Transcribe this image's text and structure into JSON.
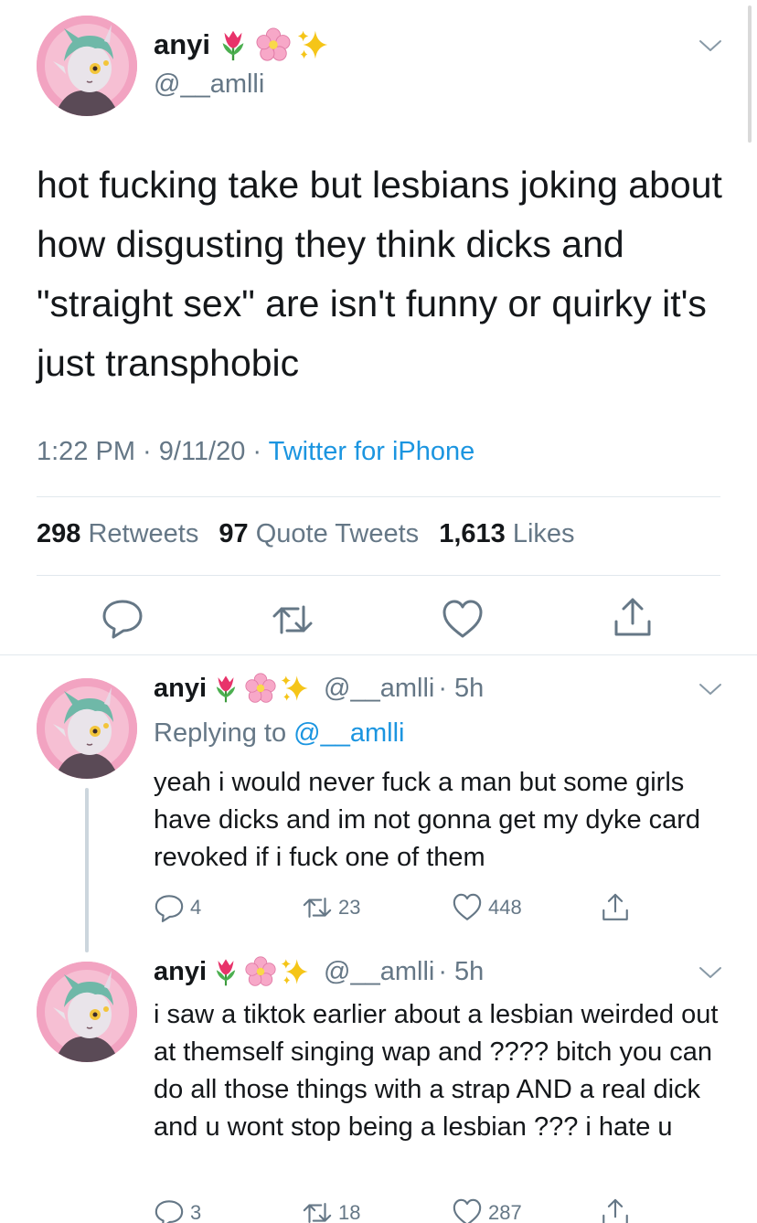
{
  "main_tweet": {
    "display_name": "anyi",
    "handle": "@__amlli",
    "text": "hot fucking take but lesbians joking about how disgusting they think dicks and \"straight sex\" are isn't funny or quirky it's just transphobic",
    "time": "1:22 PM · 9/11/20 · ",
    "source": "Twitter for iPhone",
    "stats": {
      "retweets_count": "298",
      "retweets_label": "Retweets",
      "quotes_count": "97",
      "quotes_label": "Quote Tweets",
      "likes_count": "1,613",
      "likes_label": "Likes"
    }
  },
  "emojis": [
    "tulip-emoji",
    "cherry-blossom-emoji",
    "sparkles-emoji"
  ],
  "replies": [
    {
      "display_name": "anyi",
      "handle": "@__amlli",
      "age": "· 5h",
      "replying_prefix": "Replying to ",
      "replying_to": "@__amlli",
      "text": "yeah i would never fuck a man but some girls have dicks and im not gonna get my dyke card revoked if i fuck one of them",
      "reply_count": "4",
      "retweet_count": "23",
      "like_count": "448"
    },
    {
      "display_name": "anyi",
      "handle": "@__amlli",
      "age": "· 5h",
      "text": "i saw a tiktok earlier about a lesbian weirded out at themself singing wap and ???? bitch you can do all those things with a strap AND a real dick and u wont stop being a lesbian ??? i hate u",
      "reply_count": "3",
      "retweet_count": "18",
      "like_count": "287"
    }
  ],
  "colors": {
    "text": "#14171a",
    "secondary": "#657786",
    "link": "#1b95e0",
    "divider": "#e1e8ed",
    "thread_line": "#ccd6dd"
  }
}
